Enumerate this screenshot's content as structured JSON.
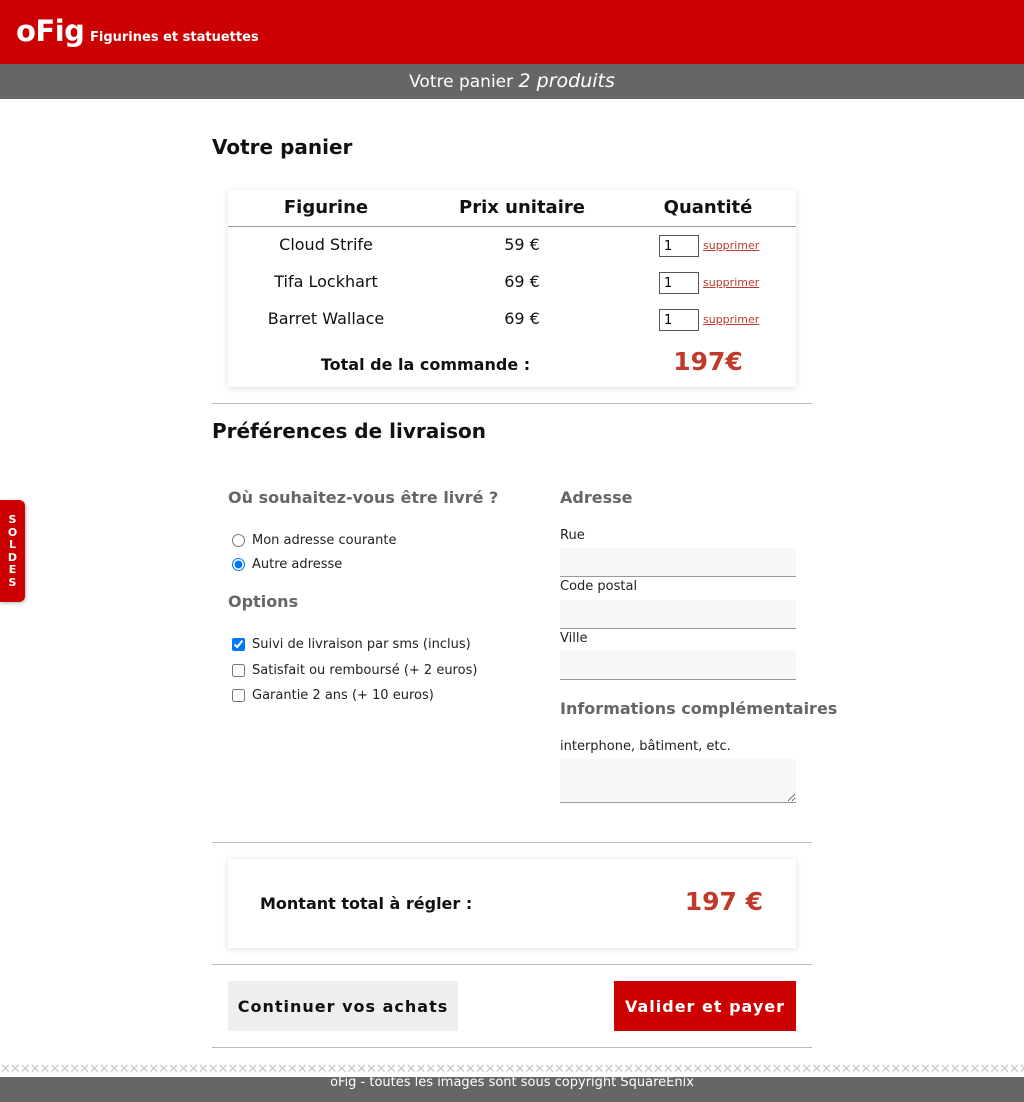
{
  "header": {
    "logo": "oFig",
    "tagline": "Figurines et statuettes"
  },
  "cartbar": {
    "prefix": "Votre panier",
    "count": "2 produits"
  },
  "sidetab": {
    "letters": [
      "S",
      "O",
      "L",
      "D",
      "E",
      "S"
    ]
  },
  "cart": {
    "title": "Votre panier",
    "columns": [
      "Figurine",
      "Prix unitaire",
      "Quantité"
    ],
    "rows": [
      {
        "name": "Cloud Strife",
        "price": "59 €",
        "qty": "1",
        "remove": "supprimer"
      },
      {
        "name": "Tifa Lockhart",
        "price": "69 €",
        "qty": "1",
        "remove": "supprimer"
      },
      {
        "name": "Barret Wallace",
        "price": "69 €",
        "qty": "1",
        "remove": "supprimer"
      }
    ],
    "total_label": "Total de la commande :",
    "total_value": "197€"
  },
  "delivery": {
    "title": "Préférences de livraison",
    "where_title": "Où souhaitez-vous être livré ?",
    "radios": [
      {
        "label": "Mon adresse courante",
        "checked": false
      },
      {
        "label": "Autre adresse",
        "checked": true
      }
    ],
    "options_title": "Options",
    "options": [
      {
        "label": "Suivi de livraison par sms (inclus)",
        "checked": true
      },
      {
        "label": "Satisfait ou remboursé (+ 2 euros)",
        "checked": false
      },
      {
        "label": "Garantie 2 ans (+ 10 euros)",
        "checked": false
      }
    ],
    "address_title": "Adresse",
    "street_label": "Rue",
    "zip_label": "Code postal",
    "city_label": "Ville",
    "info_title": "Informations complémentaires",
    "info_label": "interphone, bâtiment, etc."
  },
  "summary": {
    "label": "Montant total à régler :",
    "value": "197 €"
  },
  "buttons": {
    "continue": "Continuer vos achats",
    "pay": "Valider et payer"
  },
  "footer": {
    "text": "oFig - toutes les images sont sous copyright SquareEnix"
  }
}
